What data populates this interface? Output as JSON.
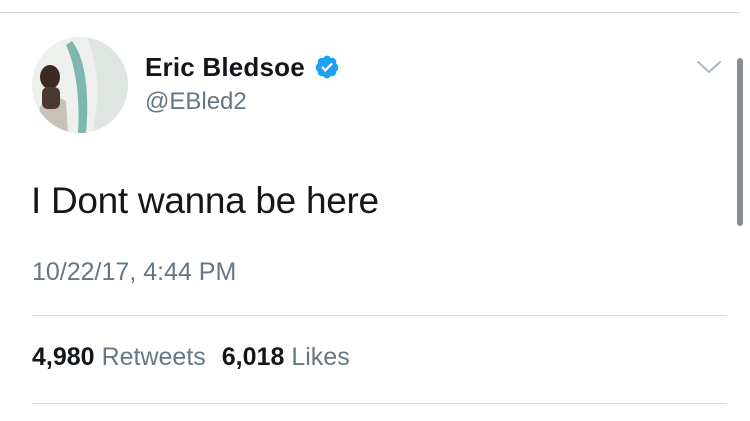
{
  "tweet": {
    "author": {
      "display_name": "Eric Bledsoe",
      "handle": "@EBled2",
      "verified": true
    },
    "text": "I Dont wanna be here",
    "timestamp": "10/22/17, 4:44 PM",
    "stats": {
      "retweets_count": "4,980",
      "retweets_label": "Retweets",
      "likes_count": "6,018",
      "likes_label": "Likes"
    }
  },
  "icons": {
    "verified": "verified-badge-icon",
    "menu": "chevron-down-icon"
  },
  "colors": {
    "verified_blue": "#1da1f2",
    "primary_text": "#14171a",
    "secondary_text": "#657786",
    "divider": "#d5dbe0"
  }
}
